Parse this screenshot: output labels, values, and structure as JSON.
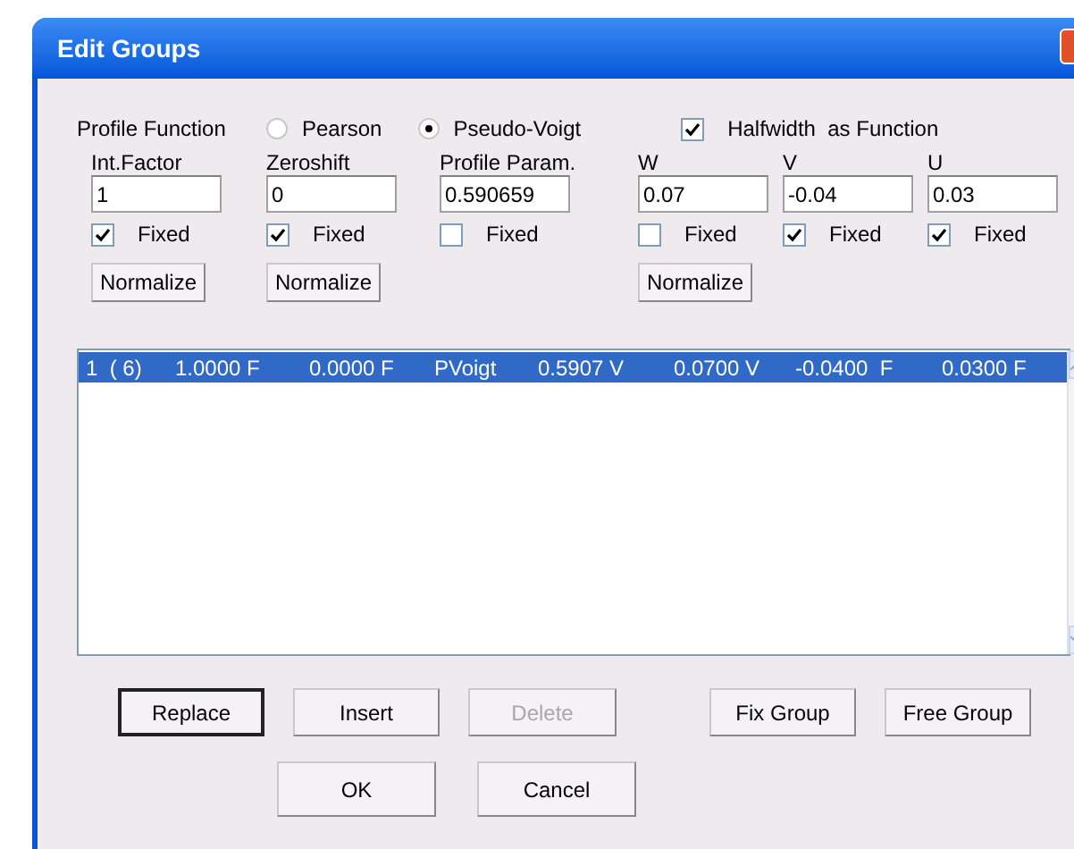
{
  "window": {
    "title": "Edit Groups"
  },
  "profile_function": {
    "label": "Profile Function",
    "options": [
      {
        "label": "Pearson",
        "selected": false
      },
      {
        "label": "Pseudo-Voigt",
        "selected": true
      }
    ]
  },
  "halfwidth": {
    "label": "Halfwidth  as Function",
    "checked": true
  },
  "params": [
    {
      "label": "Int.Factor",
      "value": "1",
      "fixed_label": "Fixed",
      "checked": true,
      "normalize": "Normalize"
    },
    {
      "label": "Zeroshift",
      "value": "0",
      "fixed_label": "Fixed",
      "checked": true,
      "normalize": "Normalize"
    },
    {
      "label": "Profile Param.",
      "value": "0.590659",
      "fixed_label": "Fixed",
      "checked": false
    },
    {
      "label": "W",
      "value": "0.07",
      "fixed_label": "Fixed",
      "checked": false,
      "normalize": "Normalize"
    },
    {
      "label": "V",
      "value": "-0.04",
      "fixed_label": "Fixed",
      "checked": true
    },
    {
      "label": "U",
      "value": "0.03",
      "fixed_label": "Fixed",
      "checked": true
    }
  ],
  "list": {
    "rows": [
      {
        "selected": true,
        "cells": [
          "1  ( 6)",
          "1.0000 F",
          "0.0000 F",
          "PVoigt",
          "0.5907 V",
          "0.0700 V",
          "-0.0400  F",
          "0.0300 F"
        ]
      }
    ]
  },
  "buttons": [
    {
      "label": "Replace",
      "default": true,
      "disabled": false
    },
    {
      "label": "Insert",
      "default": false,
      "disabled": false
    },
    {
      "label": "Delete",
      "default": false,
      "disabled": true
    },
    {
      "label": "Fix Group",
      "default": false,
      "disabled": false
    },
    {
      "label": "Free Group",
      "default": false,
      "disabled": false
    }
  ],
  "footer_buttons": [
    {
      "label": "OK"
    },
    {
      "label": "Cancel"
    }
  ]
}
